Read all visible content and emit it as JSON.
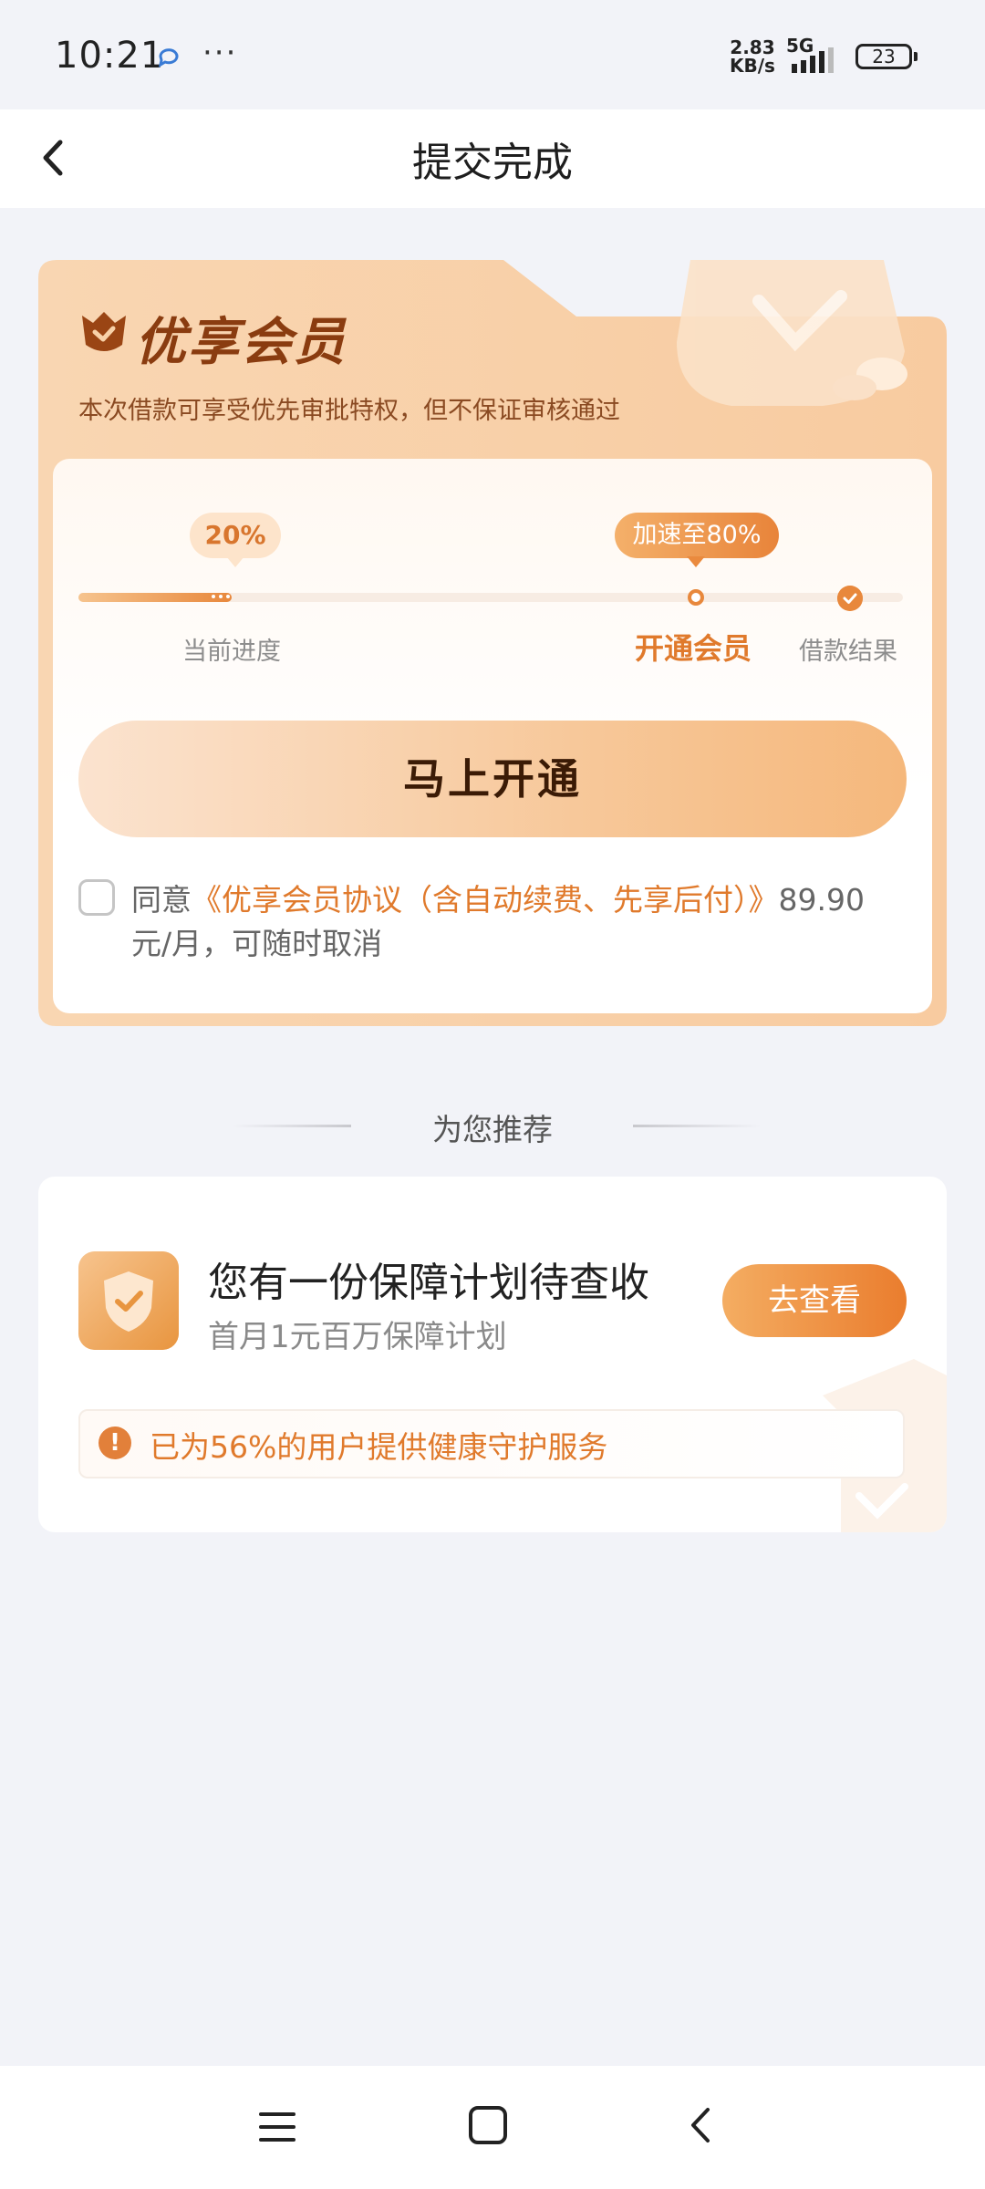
{
  "status_bar": {
    "time": "10:21",
    "more": "···",
    "speed_value": "2.83",
    "speed_unit": "KB/s",
    "network": "5G",
    "battery": "23"
  },
  "header": {
    "title": "提交完成"
  },
  "member": {
    "title": "优享会员",
    "description": "本次借款可享受优先审批特权，但不保证审核通过",
    "current_percent": "20%",
    "boost_label": "加速至80%",
    "progress_value": 0.2,
    "steps": {
      "current": "当前进度",
      "open_member": "开通会员",
      "result": "借款结果"
    },
    "open_button": "马上开通",
    "agree_prefix": "同意",
    "agree_link": "《优享会员协议（含自动续费、先享后付）》",
    "agree_price": "89.90",
    "agree_suffix": "元/月，可随时取消"
  },
  "recommend": {
    "section_title": "为您推荐",
    "headline": "您有一份保障计划待查收",
    "subtitle": "首月1元百万保障计划",
    "button": "去查看",
    "notice": "已为56%的用户提供健康守护服务"
  },
  "colors": {
    "accent": "#e07a2c",
    "card_bg": "#f8d3ab",
    "page_bg": "#f2f3f8"
  },
  "icons": {
    "back": "chevron-left-icon",
    "crown": "crown-shield-icon",
    "shield": "shield-check-icon",
    "alert": "exclamation-icon",
    "nav_menu": "menu-icon",
    "nav_home": "square-home-icon",
    "nav_back": "chevron-left-icon"
  }
}
